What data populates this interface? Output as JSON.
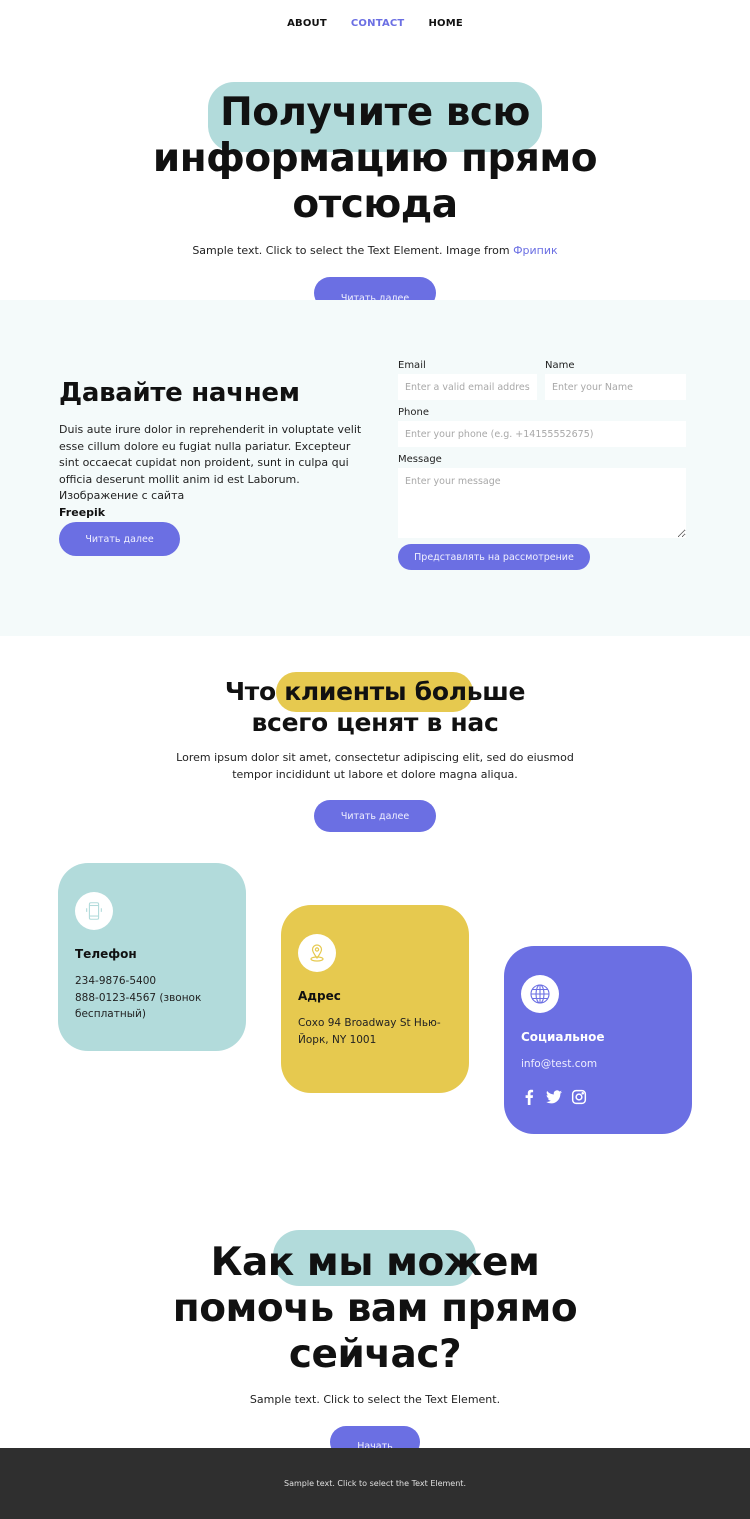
{
  "nav": {
    "items": [
      {
        "label": "ABOUT",
        "active": false
      },
      {
        "label": "CONTACT",
        "active": true
      },
      {
        "label": "HOME",
        "active": false
      }
    ]
  },
  "colors": {
    "accent": "#6b6fe3",
    "teal": "#b2dbdb",
    "yellow": "#e6c94f",
    "section_bg": "#f4fafa",
    "footer_bg": "#2f2f2f"
  },
  "hero": {
    "title_line1": "Получите всю",
    "title_line2": "информацию прямо",
    "title_line3": "отсюда",
    "subtitle": "Sample text. Click to select the Text Element. Image from ",
    "subtitle_link": "Фрипик",
    "button_label": "Читать далее"
  },
  "contact_form_section": {
    "heading": "Давайте начнем",
    "description": "Duis aute irure dolor in reprehenderit in voluptate velit esse cillum dolore eu fugiat nulla pariatur. Excepteur sint occaecat cupidat non proident, sunt in culpa qui officia deserunt mollit anim id est Laborum. Изображение с сайта ",
    "description_bold": "Freepik",
    "button_label": "Читать далее",
    "form": {
      "email": {
        "label": "Email",
        "placeholder": "Enter a valid email address",
        "value": ""
      },
      "name": {
        "label": "Name",
        "placeholder": "Enter your Name",
        "value": ""
      },
      "phone": {
        "label": "Phone",
        "placeholder": "Enter your phone (e.g. +14155552675)",
        "value": ""
      },
      "message": {
        "label": "Message",
        "placeholder": "Enter your message",
        "value": ""
      },
      "submit_label": "Представлять на рассмотрение"
    }
  },
  "clients_section": {
    "title_pre": "Что ",
    "title_highlight": "клиенты боль",
    "title_post": "ше",
    "title_line2": "всего ценят в нас",
    "subtitle_line1": "Lorem ipsum dolor sit amet, consectetur adipiscing elit, sed do eiusmod",
    "subtitle_line2": "tempor incididunt ut labore et dolore magna aliqua.",
    "button_label": "Читать далее",
    "cards": [
      {
        "icon": "phone-icon",
        "title": "Телефон",
        "lines": [
          "234-9876-5400",
          "888-0123-4567 (звонок бесплатный)"
        ]
      },
      {
        "icon": "map-pin-icon",
        "title": "Адрес",
        "lines": [
          "Сохо 94 Broadway St Нью-Йорк, NY 1001"
        ]
      },
      {
        "icon": "globe-icon",
        "title": "Социальное",
        "lines": [
          "info@test.com"
        ],
        "socials": [
          "facebook-icon",
          "twitter-icon",
          "instagram-icon"
        ]
      }
    ]
  },
  "help_section": {
    "title_line1": "Как мы можем",
    "title_line2": "помочь вам прямо",
    "title_line3": "сейчас?",
    "subtitle": "Sample text. Click to select the Text Element.",
    "button_label": "Начать"
  },
  "footer": {
    "text": "Sample text. Click to select the Text Element."
  }
}
